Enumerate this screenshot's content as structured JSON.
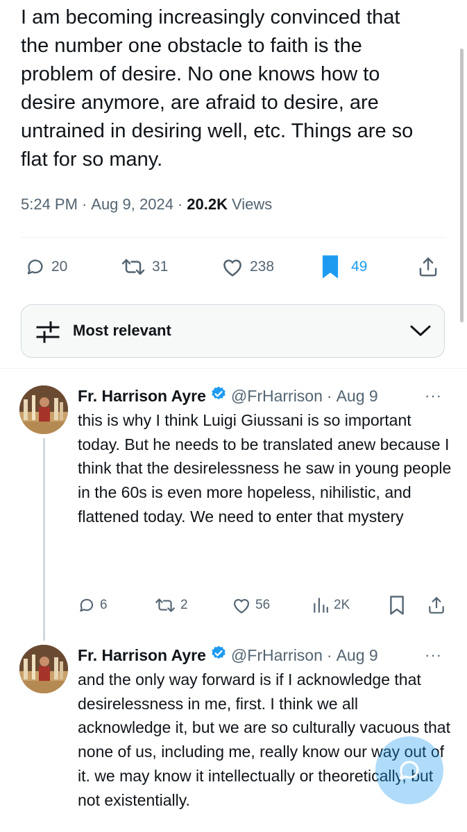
{
  "main_tweet": {
    "text": "I am becoming increasingly convinced that\nthe number one obstacle to faith is the\nproblem of desire. No one knows how to\ndesire anymore, are afraid to desire, are\nuntrained in desiring well, etc. Things are so\nflat for so many.",
    "time": "5:24 PM",
    "date": "Aug 9, 2024",
    "separator": "·",
    "views_count": "20.2K",
    "views_label": "Views",
    "replies": "20",
    "reposts": "31",
    "likes": "238",
    "bookmarks": "49",
    "bookmark_color": "#1d9bf0"
  },
  "sort": {
    "label": "Most relevant",
    "icon": "sliders-icon"
  },
  "replies": [
    {
      "name": "Fr. Harrison Ayre",
      "handle": "@FrHarrison",
      "separator": "·",
      "date": "Aug 9",
      "more": "···",
      "text": "this is why I think Luigi Giussani is so important today. But he needs to be translated anew because I think that the desirelessness he saw in young people in the 60s is even more hopeless, nihilistic, and flattened today. We need to enter that mystery",
      "replies": "6",
      "reposts": "2",
      "likes": "56",
      "views": "2K"
    },
    {
      "name": "Fr. Harrison Ayre",
      "handle": "@FrHarrison",
      "separator": "·",
      "date": "Aug 9",
      "more": "···",
      "text": "and the only way forward is if I acknowledge that desirelessness in me, first. I think we all acknowledge it, but we are so culturally vacuous that none of us, including me, really know our way out of it. we may know it intellectually or theoretically, but not existentially."
    }
  ],
  "colors": {
    "accent": "#1d9bf0",
    "verified": "#1d9bf0",
    "secondary_text": "#536471",
    "primary_text": "#0f1419"
  }
}
